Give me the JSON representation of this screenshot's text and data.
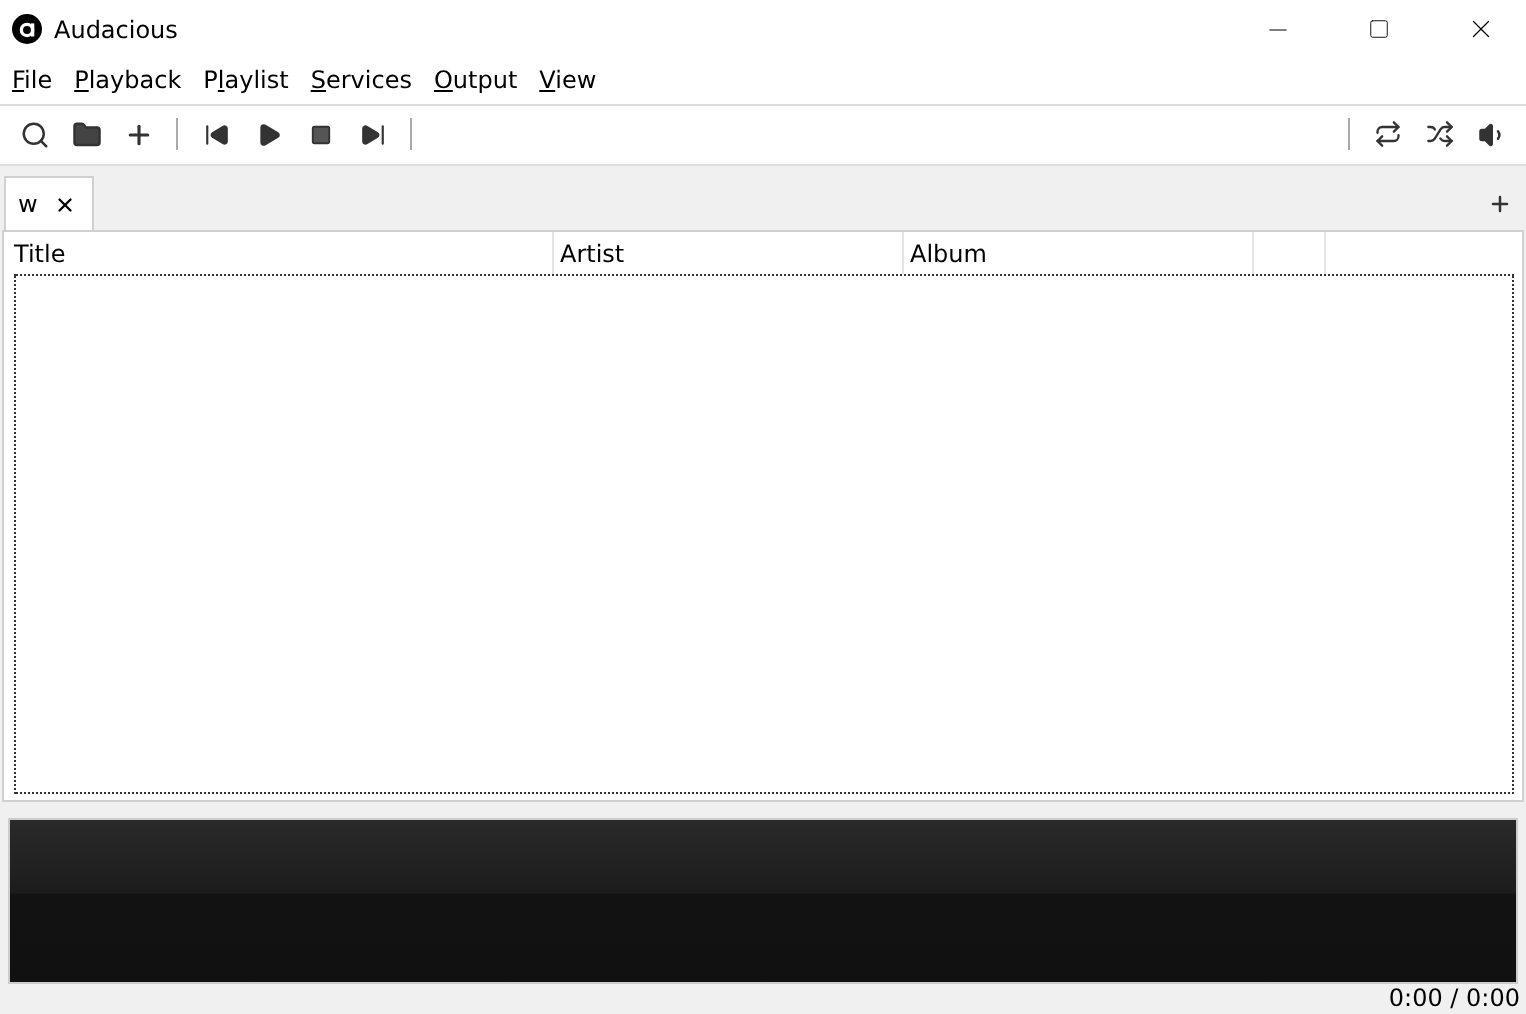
{
  "window": {
    "title": "Audacious"
  },
  "menu": [
    {
      "key": "F",
      "after": "ile"
    },
    {
      "key": "P",
      "after": "layback"
    },
    {
      "before": "P",
      "key": "l",
      "after": "aylist"
    },
    {
      "key": "S",
      "after": "ervices"
    },
    {
      "key": "O",
      "after": "utput"
    },
    {
      "key": "V",
      "after": "iew"
    }
  ],
  "tabs": [
    {
      "label": "w",
      "selected": true
    }
  ],
  "table": {
    "columns": [
      "Title",
      "Artist",
      "Album"
    ]
  },
  "status_bar": {
    "time": "0:00 / 0:00"
  }
}
